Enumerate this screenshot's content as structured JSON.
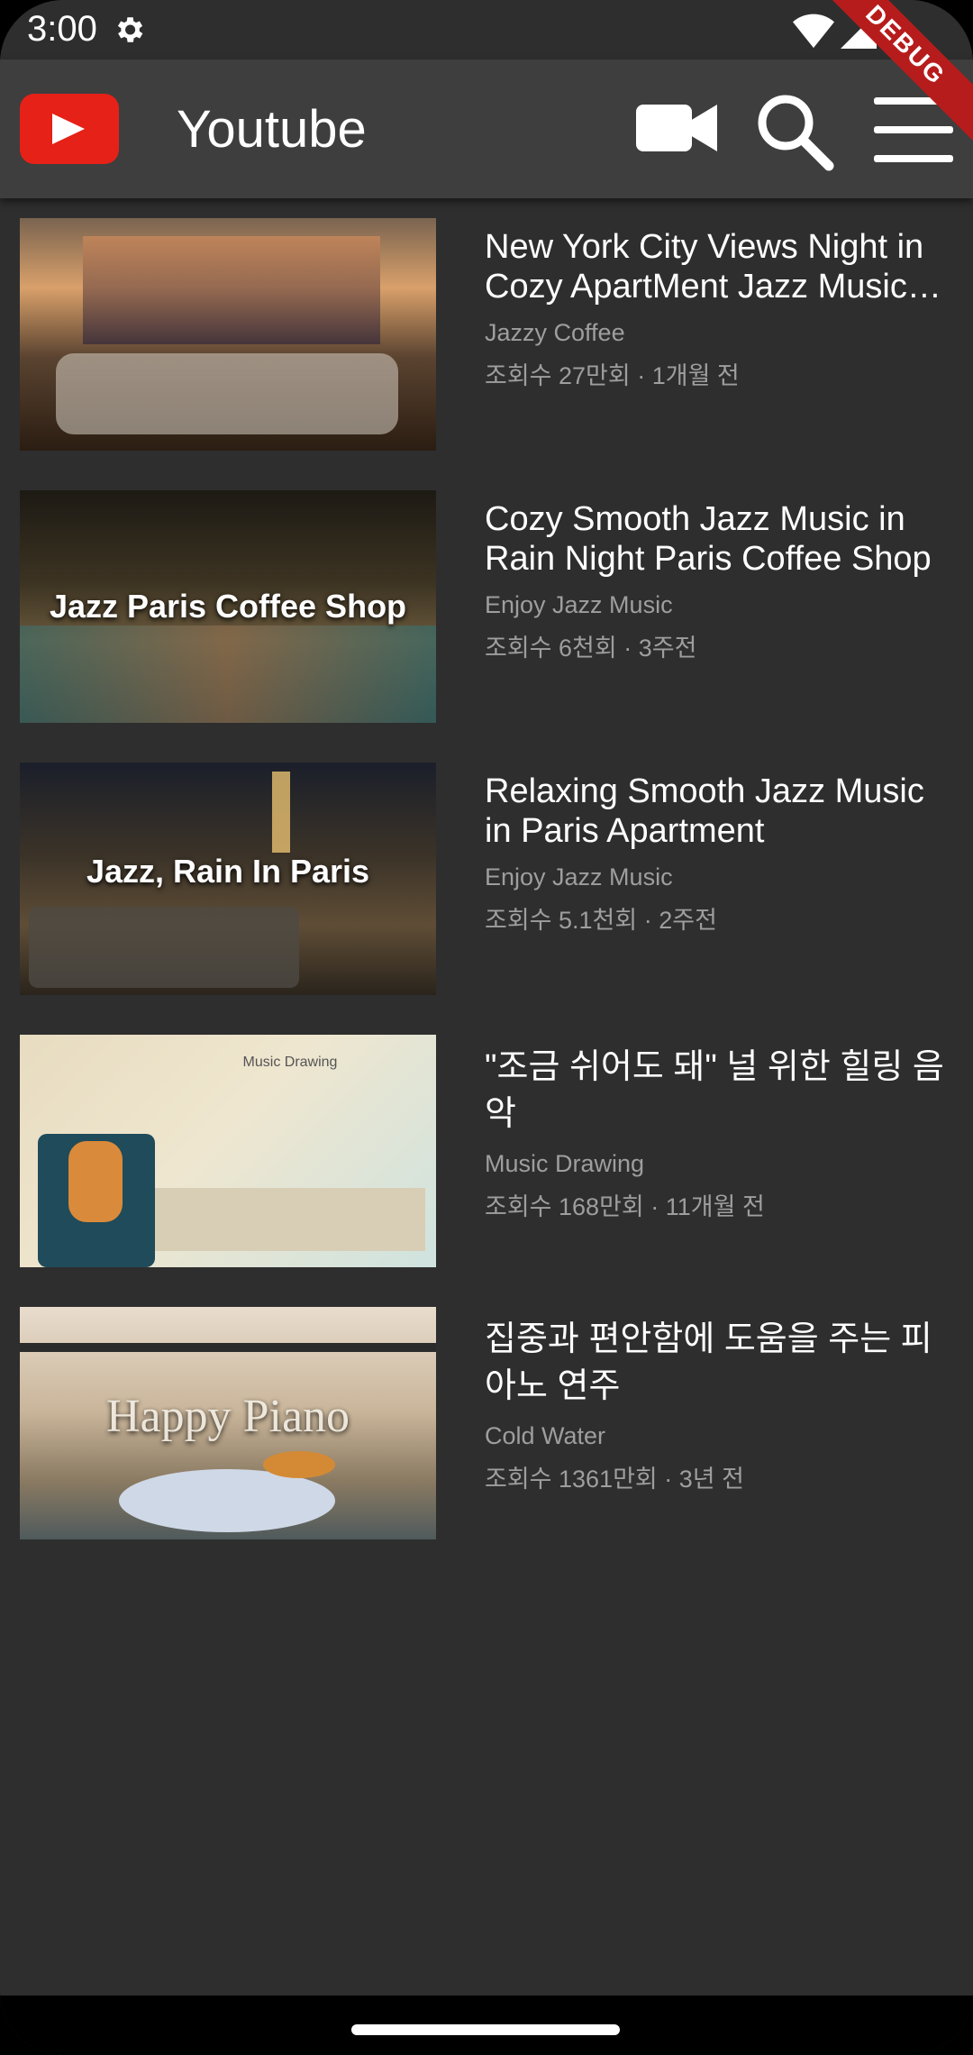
{
  "status_bar": {
    "time": "3:00",
    "debug_label": "DEBUG"
  },
  "app_bar": {
    "title": "Youtube"
  },
  "videos": [
    {
      "title": "New York City Views Night in Cozy ApartMent Jazz Music for Sleep",
      "channel": "Jazzy Coffee",
      "meta": "조회수 27만회 · 1개월 전",
      "thumb_text": ""
    },
    {
      "title": "Cozy Smooth Jazz Music in Rain Night Paris Coffee Shop",
      "channel": "Enjoy Jazz Music",
      "meta": "조회수 6천회 · 3주전",
      "thumb_text": "Jazz Paris Coffee Shop"
    },
    {
      "title": "Relaxing Smooth Jazz Music in Paris Apartment",
      "channel": "Enjoy Jazz Music",
      "meta": "조회수 5.1천회 · 2주전",
      "thumb_text": "Jazz, Rain In Paris"
    },
    {
      "title": "\"조금 쉬어도 돼\" 널 위한 힐링 음악",
      "channel": "Music Drawing",
      "meta": "조회수 168만회 · 11개월 전",
      "thumb_text": "Music Drawing"
    },
    {
      "title": "집중과 편안함에 도움을 주는 피아노 연주",
      "channel": "Cold Water",
      "meta": "조회수 1361만회 · 3년 전",
      "thumb_text": "Happy Piano"
    }
  ]
}
